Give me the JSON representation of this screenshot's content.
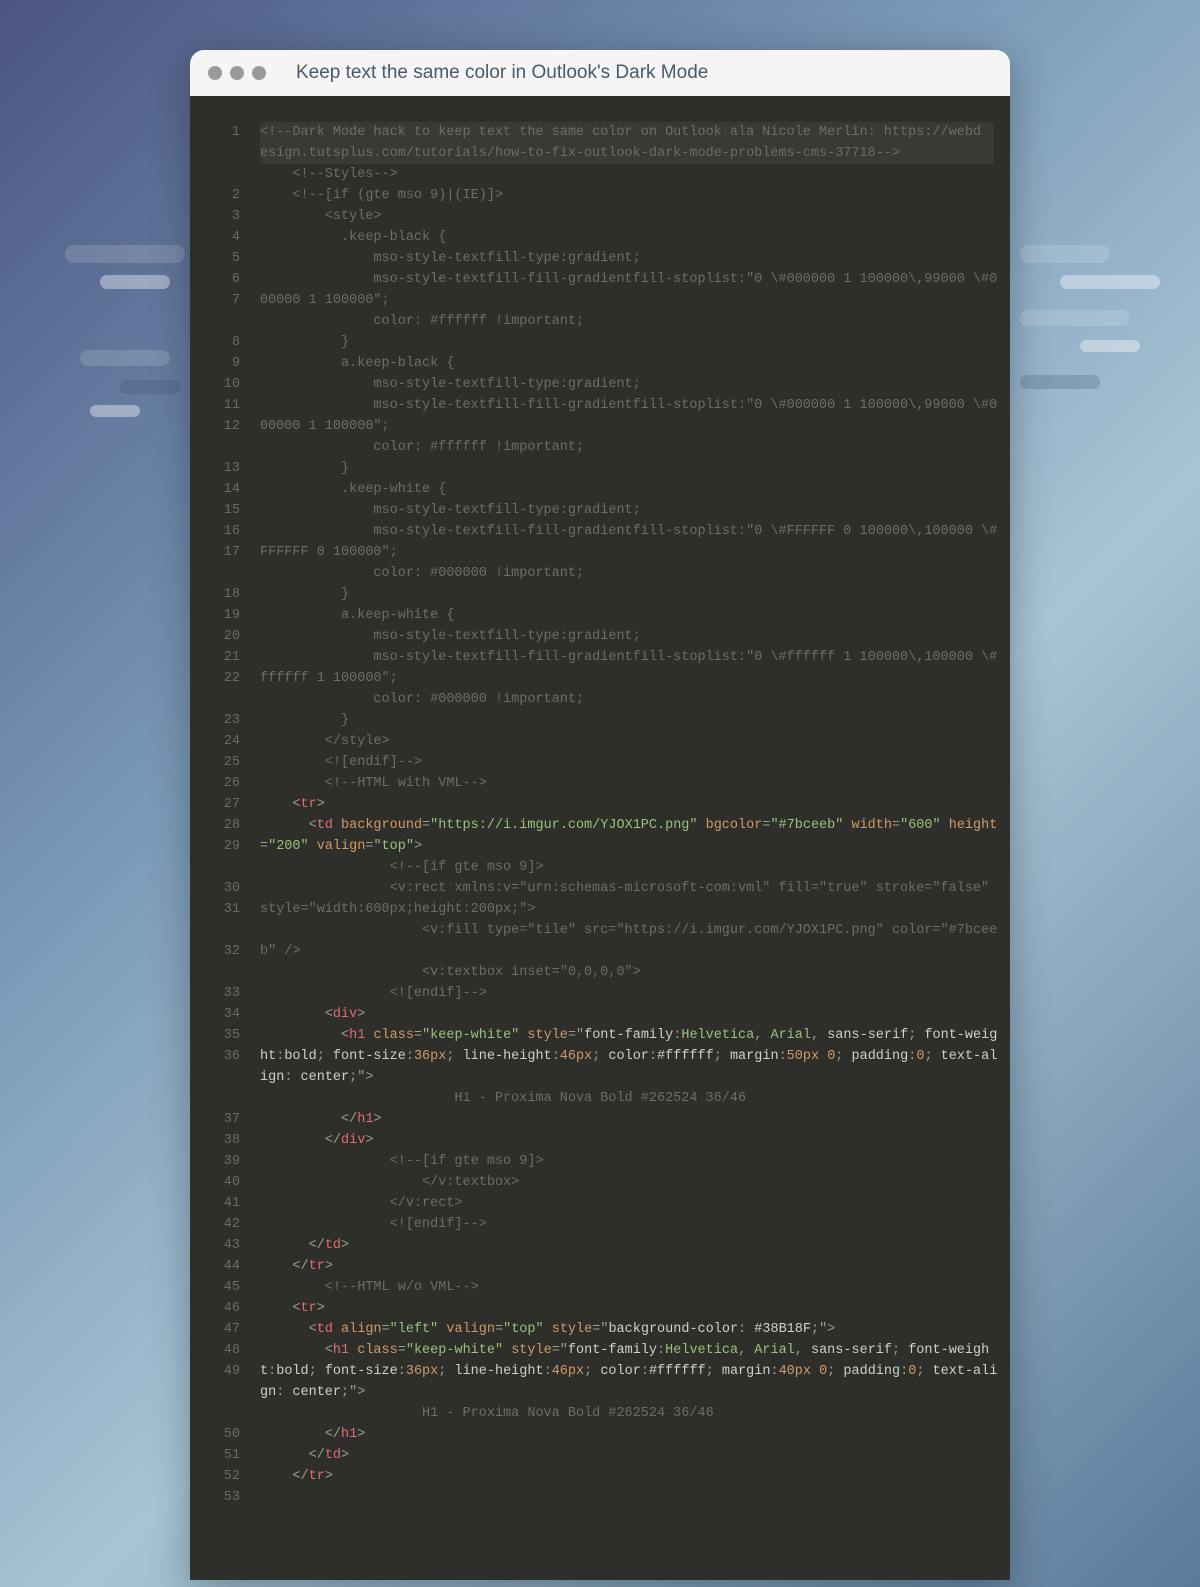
{
  "window": {
    "title": "Keep text the same color in Outlook's Dark Mode"
  },
  "code": {
    "line_count": 53,
    "lines": {
      "l1": "<!--Dark Mode hack to keep text the same color on Outlook ala Nicole Merlin: https://webdesign.tutsplus.com/tutorials/how-to-fix-outlook-dark-mode-problems-cms-37718-->",
      "l2": "  <!--Styles-->",
      "l3": "  <!--[if (gte mso 9)|(IE)]>",
      "l4": "    <style>",
      "l5": "      .keep-black {",
      "l6": "        mso-style-textfill-type:gradient;",
      "l7a": "        mso-style-textfill-fill-gradientfill-stoplist:\"0 \\#000000 1 ",
      "l7b": "100000\\,99000 \\#000000 1 100000\";",
      "l8": "        color: #ffffff !important;",
      "l9": "      }",
      "l10": "      a.keep-black {",
      "l11": "        mso-style-textfill-type:gradient;",
      "l12a": "        mso-style-textfill-fill-gradientfill-stoplist:\"0 \\#000000 1 ",
      "l12b": "100000\\,99000 \\#000000 1 100000\";",
      "l13": "        color: #ffffff !important;",
      "l14": "      }",
      "l15": "      .keep-white {",
      "l16": "        mso-style-textfill-type:gradient;",
      "l17a": "        mso-style-textfill-fill-gradientfill-stoplist:\"0 \\#FFFFFF 0 ",
      "l17b": "100000\\,100000 \\#FFFFFF 0 100000\";",
      "l18": "        color: #000000 !important;",
      "l19": "      }",
      "l20": "      a.keep-white {",
      "l21": "        mso-style-textfill-type:gradient;",
      "l22a": "        mso-style-textfill-fill-gradientfill-stoplist:\"0 \\#ffffff 1 ",
      "l22b": "100000\\,100000 \\#ffffff 1 100000\";",
      "l23": "        color: #000000 !important;",
      "l24": "      }",
      "l25": "    </style>",
      "l26": "    <![endif]-->",
      "l27": "    <!--HTML with VML-->",
      "l28": "    <tr>",
      "l29_td": "td",
      "l29_bg_attr": "background",
      "l29_bg_val": "\"https://i.imgur.com/YJOX1PC.png\"",
      "l29_bgc_attr": "bgcolor",
      "l29_bgc_val": "\"#7bceeb\"",
      "l29_w_attr": "width",
      "l29_w_val": "\"600\"",
      "l29_h_attr": "height",
      "l29_h_val": "\"200\"",
      "l29_v_attr": "valign",
      "l29_v_val": "\"top\"",
      "l30": "        <!--[if gte mso 9]>",
      "l31a": "        <v:rect xmlns:v=\"urn:schemas-microsoft-com:vml\" fill=\"true\" ",
      "l31b": "stroke=\"false\" style=\"width:600px;height:200px;\">",
      "l32a": "          <v:fill type=\"tile\" src=\"https://i.imgur.com/YJOX1PC.png\" ",
      "l32b": "color=\"#7bceeb\" />",
      "l33": "          <v:textbox inset=\"0,0,0,0\">",
      "l34": "        <![endif]-->",
      "l35": "        <div>",
      "l36_h1": "h1",
      "l36_class_attr": "class",
      "l36_class_val": "\"keep-white\"",
      "l36_style_attr": "style",
      "l36_ff": "font-family",
      "l36_helv": "Helvetica",
      "l36_arial": "Arial",
      "l36_sans": "sans-serif",
      "l36_fw": "font-weight",
      "l36_bold": "bold",
      "l36_fs": "font-size",
      "l36_36": "36px",
      "l36_lh": "line-height",
      "l36_46": "46px",
      "l36_color": "color",
      "l36_fff": "#ffffff",
      "l36_margin": "margin",
      "l36_50": "50px",
      "l36_0": "0",
      "l36_pad": "padding",
      "l36_ta": "text-align",
      "l36_center": "center",
      "l37": "            H1 - Proxima Nova Bold #262524 36/46",
      "l38": "          </h1>",
      "l39": "        </div>",
      "l40": "        <!--[if gte mso 9]>",
      "l41": "          </v:textbox>",
      "l42": "        </v:rect>",
      "l43": "        <![endif]-->",
      "l44": "      </td>",
      "l45": "    </tr>",
      "l46": "    <!--HTML w/o VML-->",
      "l47": "    <tr>",
      "l48_td": "td",
      "l48_align_attr": "align",
      "l48_align_val": "\"left\"",
      "l48_valign_attr": "valign",
      "l48_valign_val": "\"top\"",
      "l48_style_attr": "style",
      "l48_bgc": "background-color",
      "l48_38b": "#38B18F",
      "l49_40": "40px",
      "l50": "          H1 - Proxima Nova Bold #262524 36/46",
      "l51": "        </h1>",
      "l52": "      </td>",
      "l53": "    </tr>"
    }
  }
}
